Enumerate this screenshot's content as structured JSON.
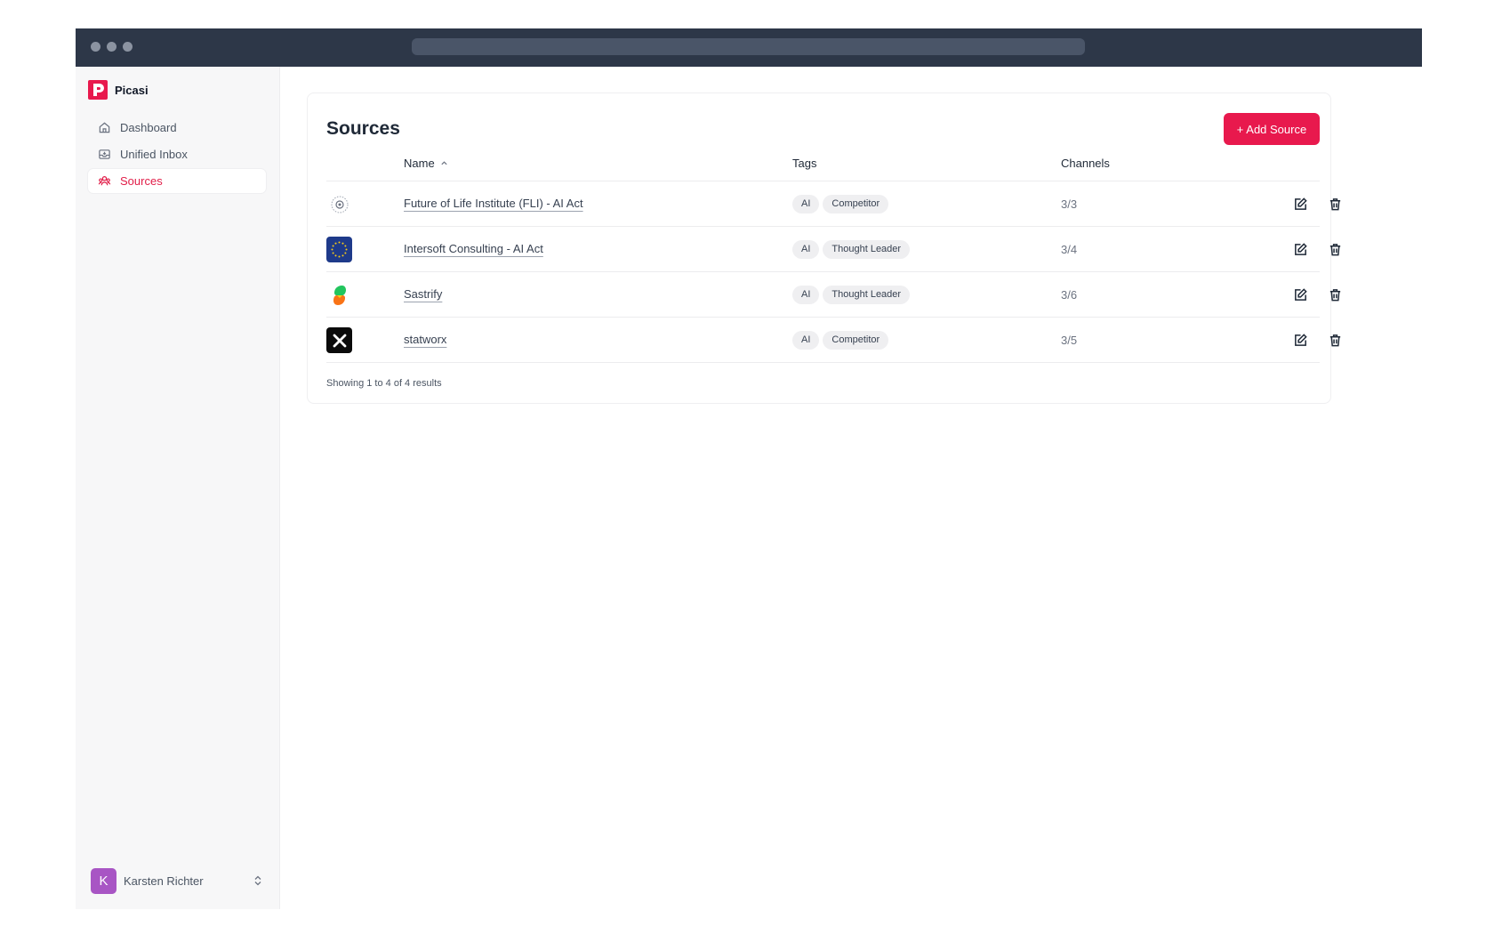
{
  "app": {
    "name": "Picasi",
    "brand_color": "#e8194d"
  },
  "sidebar": {
    "items": [
      {
        "label": "Dashboard",
        "icon": "home-icon",
        "active": false
      },
      {
        "label": "Unified Inbox",
        "icon": "inbox-icon",
        "active": false
      },
      {
        "label": "Sources",
        "icon": "sources-icon",
        "active": true
      }
    ],
    "user": {
      "initial": "K",
      "name": "Karsten Richter",
      "avatar_color": "#a855c4"
    }
  },
  "main": {
    "title": "Sources",
    "add_button": "+ Add Source",
    "columns": {
      "name": "Name",
      "tags": "Tags",
      "channels": "Channels"
    },
    "sort": {
      "column": "name",
      "direction": "ascending"
    },
    "rows": [
      {
        "logo": "fli-logo",
        "name": "Future of Life Institute (FLI) - AI Act",
        "tags": [
          "AI",
          "Competitor"
        ],
        "channels": "3/3"
      },
      {
        "logo": "eu-flag-logo",
        "name": "Intersoft Consulting - AI Act",
        "tags": [
          "AI",
          "Thought Leader"
        ],
        "channels": "3/4"
      },
      {
        "logo": "sastrify-logo",
        "name": "Sastrify",
        "tags": [
          "AI",
          "Thought Leader"
        ],
        "channels": "3/6"
      },
      {
        "logo": "x-logo",
        "name": "statworx",
        "tags": [
          "AI",
          "Competitor"
        ],
        "channels": "3/5"
      }
    ],
    "footer": "Showing 1 to 4 of 4 results"
  }
}
